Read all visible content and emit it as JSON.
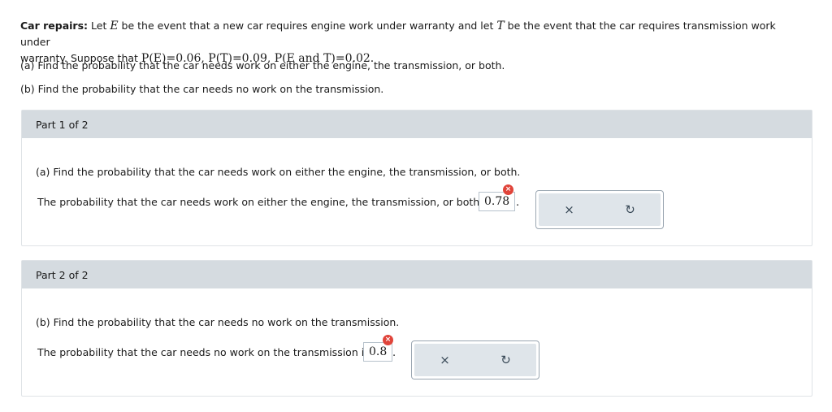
{
  "intro": {
    "bold_label": "Car repairs:",
    "text_1": " Let ",
    "var_e": "E",
    "text_2": " be the event that a new car requires engine work under warranty and let ",
    "var_t": "T",
    "text_3": " be the event that the car requires transmission work under",
    "line2_start": "warranty. Suppose that ",
    "formula": "P(E)=0.06, P(T)=0.09, P(E and T)=0.02."
  },
  "questions": {
    "a": "(a) Find the probability that the car needs work on either the engine, the transmission, or both.",
    "b": "(b) Find the probability that the car needs no work on the transmission."
  },
  "part1": {
    "header": "Part 1 of 2",
    "question": "(a) Find the probability that the car needs work on either the engine, the transmission, or both.",
    "answer_prefix": "The probability that the car needs work on either the engine, the transmission, or both is",
    "answer_value": "0.78",
    "suffix": "."
  },
  "part2": {
    "header": "Part 2 of 2",
    "question": "(b) Find the probability that the car needs no work on the transmission.",
    "answer_prefix": "The probability that the car needs no work on the transmission is",
    "answer_value": "0.8",
    "suffix": "."
  },
  "icons": {
    "error": "×",
    "clear": "×",
    "reset": "↻"
  },
  "colors": {
    "error_red": "#e0443a",
    "header_gray": "#d5dbe0"
  }
}
